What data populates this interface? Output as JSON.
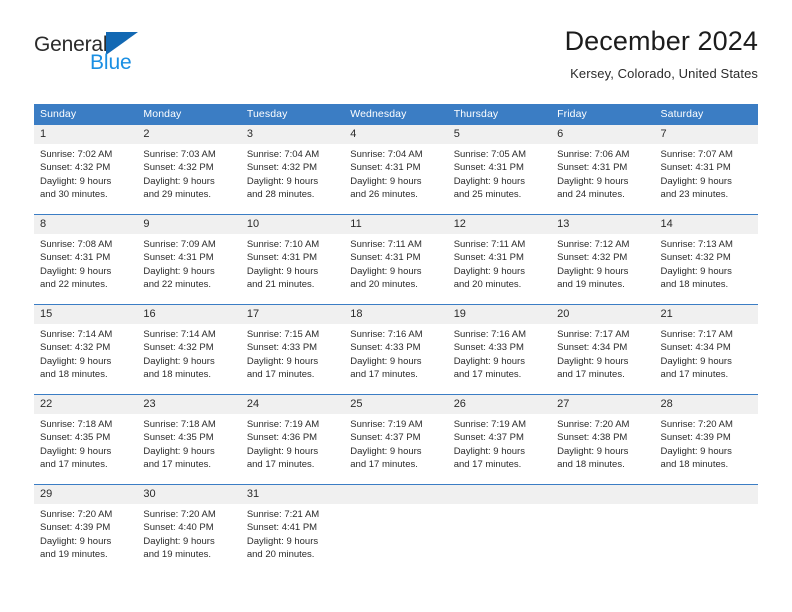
{
  "brand": {
    "name_part1": "General",
    "name_part2": "Blue",
    "triangle_color": "#1268b3",
    "blue_color": "#1a8fe3"
  },
  "header": {
    "title": "December 2024",
    "subtitle": "Kersey, Colorado, United States"
  },
  "theme": {
    "header_blue": "#3b7dc4",
    "band_gray": "#f0f0f0",
    "text_dark": "#2b2b2b"
  },
  "calendar": {
    "day_names": [
      "Sunday",
      "Monday",
      "Tuesday",
      "Wednesday",
      "Thursday",
      "Friday",
      "Saturday"
    ],
    "weeks": [
      [
        {
          "day": "1",
          "sunrise": "Sunrise: 7:02 AM",
          "sunset": "Sunset: 4:32 PM",
          "daylight1": "Daylight: 9 hours",
          "daylight2": "and 30 minutes."
        },
        {
          "day": "2",
          "sunrise": "Sunrise: 7:03 AM",
          "sunset": "Sunset: 4:32 PM",
          "daylight1": "Daylight: 9 hours",
          "daylight2": "and 29 minutes."
        },
        {
          "day": "3",
          "sunrise": "Sunrise: 7:04 AM",
          "sunset": "Sunset: 4:32 PM",
          "daylight1": "Daylight: 9 hours",
          "daylight2": "and 28 minutes."
        },
        {
          "day": "4",
          "sunrise": "Sunrise: 7:04 AM",
          "sunset": "Sunset: 4:31 PM",
          "daylight1": "Daylight: 9 hours",
          "daylight2": "and 26 minutes."
        },
        {
          "day": "5",
          "sunrise": "Sunrise: 7:05 AM",
          "sunset": "Sunset: 4:31 PM",
          "daylight1": "Daylight: 9 hours",
          "daylight2": "and 25 minutes."
        },
        {
          "day": "6",
          "sunrise": "Sunrise: 7:06 AM",
          "sunset": "Sunset: 4:31 PM",
          "daylight1": "Daylight: 9 hours",
          "daylight2": "and 24 minutes."
        },
        {
          "day": "7",
          "sunrise": "Sunrise: 7:07 AM",
          "sunset": "Sunset: 4:31 PM",
          "daylight1": "Daylight: 9 hours",
          "daylight2": "and 23 minutes."
        }
      ],
      [
        {
          "day": "8",
          "sunrise": "Sunrise: 7:08 AM",
          "sunset": "Sunset: 4:31 PM",
          "daylight1": "Daylight: 9 hours",
          "daylight2": "and 22 minutes."
        },
        {
          "day": "9",
          "sunrise": "Sunrise: 7:09 AM",
          "sunset": "Sunset: 4:31 PM",
          "daylight1": "Daylight: 9 hours",
          "daylight2": "and 22 minutes."
        },
        {
          "day": "10",
          "sunrise": "Sunrise: 7:10 AM",
          "sunset": "Sunset: 4:31 PM",
          "daylight1": "Daylight: 9 hours",
          "daylight2": "and 21 minutes."
        },
        {
          "day": "11",
          "sunrise": "Sunrise: 7:11 AM",
          "sunset": "Sunset: 4:31 PM",
          "daylight1": "Daylight: 9 hours",
          "daylight2": "and 20 minutes."
        },
        {
          "day": "12",
          "sunrise": "Sunrise: 7:11 AM",
          "sunset": "Sunset: 4:31 PM",
          "daylight1": "Daylight: 9 hours",
          "daylight2": "and 20 minutes."
        },
        {
          "day": "13",
          "sunrise": "Sunrise: 7:12 AM",
          "sunset": "Sunset: 4:32 PM",
          "daylight1": "Daylight: 9 hours",
          "daylight2": "and 19 minutes."
        },
        {
          "day": "14",
          "sunrise": "Sunrise: 7:13 AM",
          "sunset": "Sunset: 4:32 PM",
          "daylight1": "Daylight: 9 hours",
          "daylight2": "and 18 minutes."
        }
      ],
      [
        {
          "day": "15",
          "sunrise": "Sunrise: 7:14 AM",
          "sunset": "Sunset: 4:32 PM",
          "daylight1": "Daylight: 9 hours",
          "daylight2": "and 18 minutes."
        },
        {
          "day": "16",
          "sunrise": "Sunrise: 7:14 AM",
          "sunset": "Sunset: 4:32 PM",
          "daylight1": "Daylight: 9 hours",
          "daylight2": "and 18 minutes."
        },
        {
          "day": "17",
          "sunrise": "Sunrise: 7:15 AM",
          "sunset": "Sunset: 4:33 PM",
          "daylight1": "Daylight: 9 hours",
          "daylight2": "and 17 minutes."
        },
        {
          "day": "18",
          "sunrise": "Sunrise: 7:16 AM",
          "sunset": "Sunset: 4:33 PM",
          "daylight1": "Daylight: 9 hours",
          "daylight2": "and 17 minutes."
        },
        {
          "day": "19",
          "sunrise": "Sunrise: 7:16 AM",
          "sunset": "Sunset: 4:33 PM",
          "daylight1": "Daylight: 9 hours",
          "daylight2": "and 17 minutes."
        },
        {
          "day": "20",
          "sunrise": "Sunrise: 7:17 AM",
          "sunset": "Sunset: 4:34 PM",
          "daylight1": "Daylight: 9 hours",
          "daylight2": "and 17 minutes."
        },
        {
          "day": "21",
          "sunrise": "Sunrise: 7:17 AM",
          "sunset": "Sunset: 4:34 PM",
          "daylight1": "Daylight: 9 hours",
          "daylight2": "and 17 minutes."
        }
      ],
      [
        {
          "day": "22",
          "sunrise": "Sunrise: 7:18 AM",
          "sunset": "Sunset: 4:35 PM",
          "daylight1": "Daylight: 9 hours",
          "daylight2": "and 17 minutes."
        },
        {
          "day": "23",
          "sunrise": "Sunrise: 7:18 AM",
          "sunset": "Sunset: 4:35 PM",
          "daylight1": "Daylight: 9 hours",
          "daylight2": "and 17 minutes."
        },
        {
          "day": "24",
          "sunrise": "Sunrise: 7:19 AM",
          "sunset": "Sunset: 4:36 PM",
          "daylight1": "Daylight: 9 hours",
          "daylight2": "and 17 minutes."
        },
        {
          "day": "25",
          "sunrise": "Sunrise: 7:19 AM",
          "sunset": "Sunset: 4:37 PM",
          "daylight1": "Daylight: 9 hours",
          "daylight2": "and 17 minutes."
        },
        {
          "day": "26",
          "sunrise": "Sunrise: 7:19 AM",
          "sunset": "Sunset: 4:37 PM",
          "daylight1": "Daylight: 9 hours",
          "daylight2": "and 17 minutes."
        },
        {
          "day": "27",
          "sunrise": "Sunrise: 7:20 AM",
          "sunset": "Sunset: 4:38 PM",
          "daylight1": "Daylight: 9 hours",
          "daylight2": "and 18 minutes."
        },
        {
          "day": "28",
          "sunrise": "Sunrise: 7:20 AM",
          "sunset": "Sunset: 4:39 PM",
          "daylight1": "Daylight: 9 hours",
          "daylight2": "and 18 minutes."
        }
      ],
      [
        {
          "day": "29",
          "sunrise": "Sunrise: 7:20 AM",
          "sunset": "Sunset: 4:39 PM",
          "daylight1": "Daylight: 9 hours",
          "daylight2": "and 19 minutes."
        },
        {
          "day": "30",
          "sunrise": "Sunrise: 7:20 AM",
          "sunset": "Sunset: 4:40 PM",
          "daylight1": "Daylight: 9 hours",
          "daylight2": "and 19 minutes."
        },
        {
          "day": "31",
          "sunrise": "Sunrise: 7:21 AM",
          "sunset": "Sunset: 4:41 PM",
          "daylight1": "Daylight: 9 hours",
          "daylight2": "and 20 minutes."
        },
        {
          "day": "",
          "sunrise": "",
          "sunset": "",
          "daylight1": "",
          "daylight2": ""
        },
        {
          "day": "",
          "sunrise": "",
          "sunset": "",
          "daylight1": "",
          "daylight2": ""
        },
        {
          "day": "",
          "sunrise": "",
          "sunset": "",
          "daylight1": "",
          "daylight2": ""
        },
        {
          "day": "",
          "sunrise": "",
          "sunset": "",
          "daylight1": "",
          "daylight2": ""
        }
      ]
    ]
  }
}
